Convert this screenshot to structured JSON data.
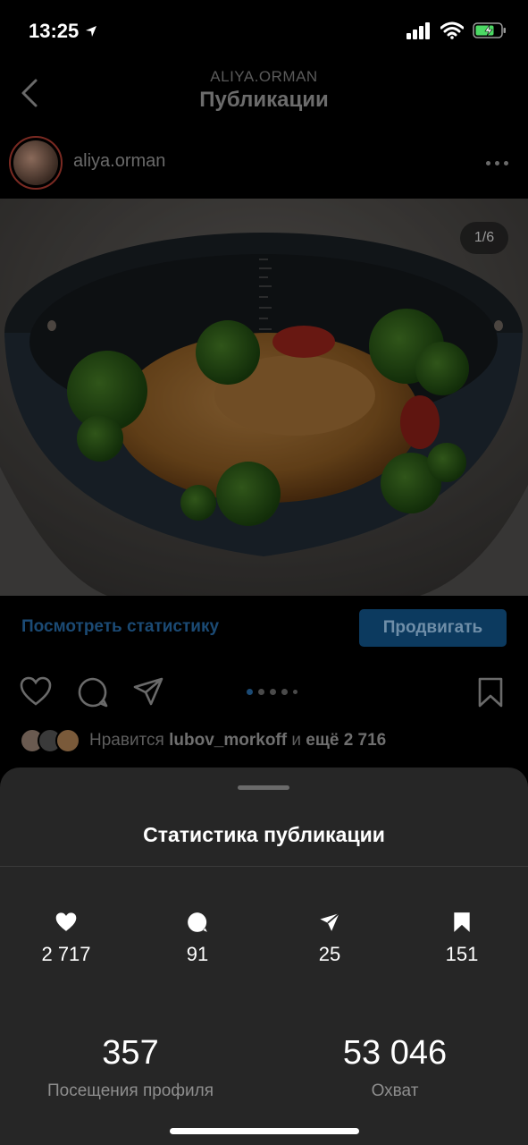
{
  "status_bar": {
    "time": "13:25"
  },
  "nav": {
    "subtitle": "ALIYA.ORMAN",
    "title": "Публикации"
  },
  "post": {
    "username": "aliya.orman",
    "image_counter": "1/6",
    "view_stats_label": "Посмотреть статистику",
    "promote_label": "Продвигать",
    "likes": {
      "prefix": "Нравится ",
      "user": "lubov_morkoff",
      "middle": " и ",
      "others": "ещё 2 716"
    }
  },
  "insights": {
    "title": "Статистика публикации",
    "metrics": [
      {
        "icon": "heart-icon",
        "value": "2 717"
      },
      {
        "icon": "comment-icon",
        "value": "91"
      },
      {
        "icon": "share-icon",
        "value": "25"
      },
      {
        "icon": "bookmark-icon",
        "value": "151"
      }
    ],
    "profile_visits": {
      "value": "357",
      "label": "Посещения профиля"
    },
    "reach": {
      "value": "53 046",
      "label": "Охват"
    }
  }
}
